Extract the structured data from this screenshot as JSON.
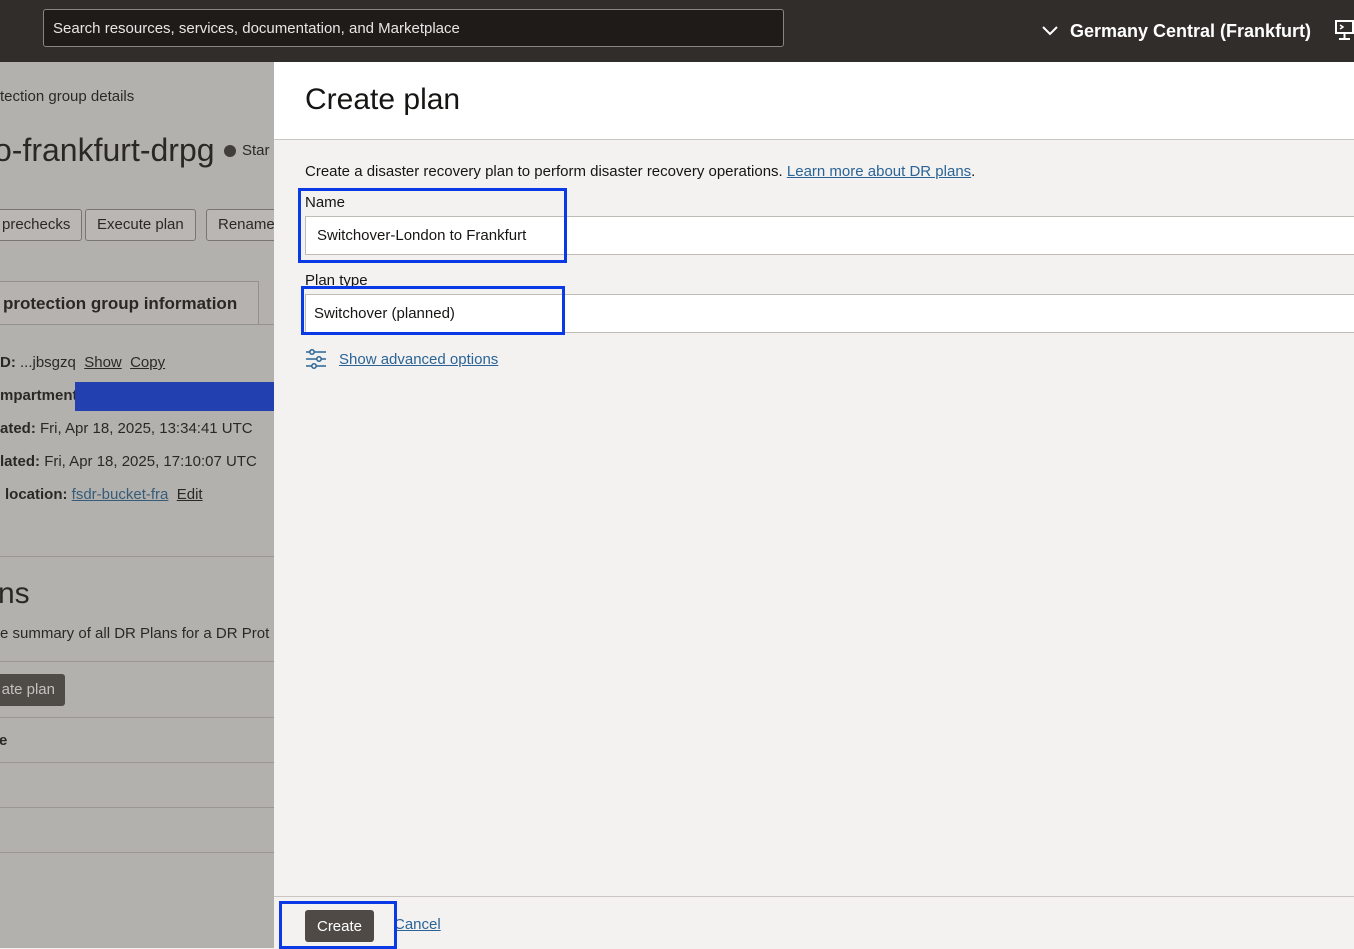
{
  "topbar": {
    "search_placeholder": "Search resources, services, documentation, and Marketplace",
    "region": "Germany Central (Frankfurt)"
  },
  "background_page": {
    "breadcrumb": "tection group details",
    "title": "o-frankfurt-drpg",
    "status": "Star",
    "buttons": [
      "prechecks",
      "Execute plan",
      "Rename"
    ],
    "tab": "protection group information",
    "info": {
      "ocid_label": "D:",
      "ocid_value": "...jbsgzq",
      "show": "Show",
      "copy": "Copy",
      "compartment_label": "mpartment",
      "created_label": "ated:",
      "created_value": "Fri, Apr 18, 2025, 13:34:41 UTC",
      "updated_label": "lated:",
      "updated_value": "Fri, Apr 18, 2025, 17:10:07 UTC",
      "location_label": "location:",
      "location_value": "fsdr-bucket-fra",
      "edit": "Edit"
    },
    "plans_heading": "ns",
    "plans_desc": "e summary of all DR Plans for a DR Prot",
    "create_plan": "ate plan",
    "table_header": "e"
  },
  "panel": {
    "title": "Create plan",
    "intro": "Create a disaster recovery plan to perform disaster recovery operations.",
    "learn_more": "Learn more about DR plans",
    "intro_end": ".",
    "name_label": "Name",
    "name_value": "Switchover-London to Frankfurt",
    "plan_type_label": "Plan type",
    "plan_type_value": "Switchover (planned)",
    "advanced": "Show advanced options",
    "create": "Create",
    "cancel": "Cancel"
  },
  "colors": {
    "highlight": "#0a3ae6",
    "topbar": "#312d2a",
    "link": "#2a6496"
  }
}
